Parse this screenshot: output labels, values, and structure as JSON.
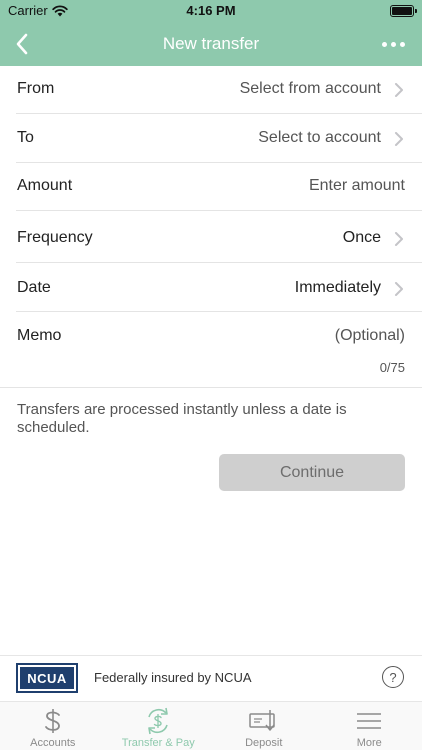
{
  "statusbar": {
    "carrier": "Carrier",
    "time": "4:16 PM"
  },
  "navbar": {
    "title": "New transfer",
    "back_icon": "chevron-left-icon",
    "menu_icon": "more-dots-icon"
  },
  "form": {
    "from": {
      "label": "From",
      "value": "Select from account"
    },
    "to": {
      "label": "To",
      "value": "Select to account"
    },
    "amount": {
      "label": "Amount",
      "placeholder": "Enter amount"
    },
    "frequency": {
      "label": "Frequency",
      "value": "Once"
    },
    "date": {
      "label": "Date",
      "value": "Immediately"
    },
    "memo": {
      "label": "Memo",
      "placeholder": "(Optional)",
      "counter": "0/75"
    }
  },
  "note": "Transfers are processed instantly unless a date is scheduled.",
  "continue_label": "Continue",
  "footer": {
    "logo_text": "NCUA",
    "insured_text": "Federally insured by NCUA",
    "help_symbol": "?"
  },
  "tabs": [
    {
      "label": "Accounts",
      "icon": "dollar-icon",
      "active": false
    },
    {
      "label": "Transfer & Pay",
      "icon": "transfer-dollar-icon",
      "active": true
    },
    {
      "label": "Deposit",
      "icon": "check-deposit-icon",
      "active": false
    },
    {
      "label": "More",
      "icon": "menu-lines-icon",
      "active": false
    }
  ],
  "colors": {
    "accent": "#8ec9ad",
    "button_disabled": "#cfcfcf",
    "ncua_blue": "#1f3f6e"
  }
}
